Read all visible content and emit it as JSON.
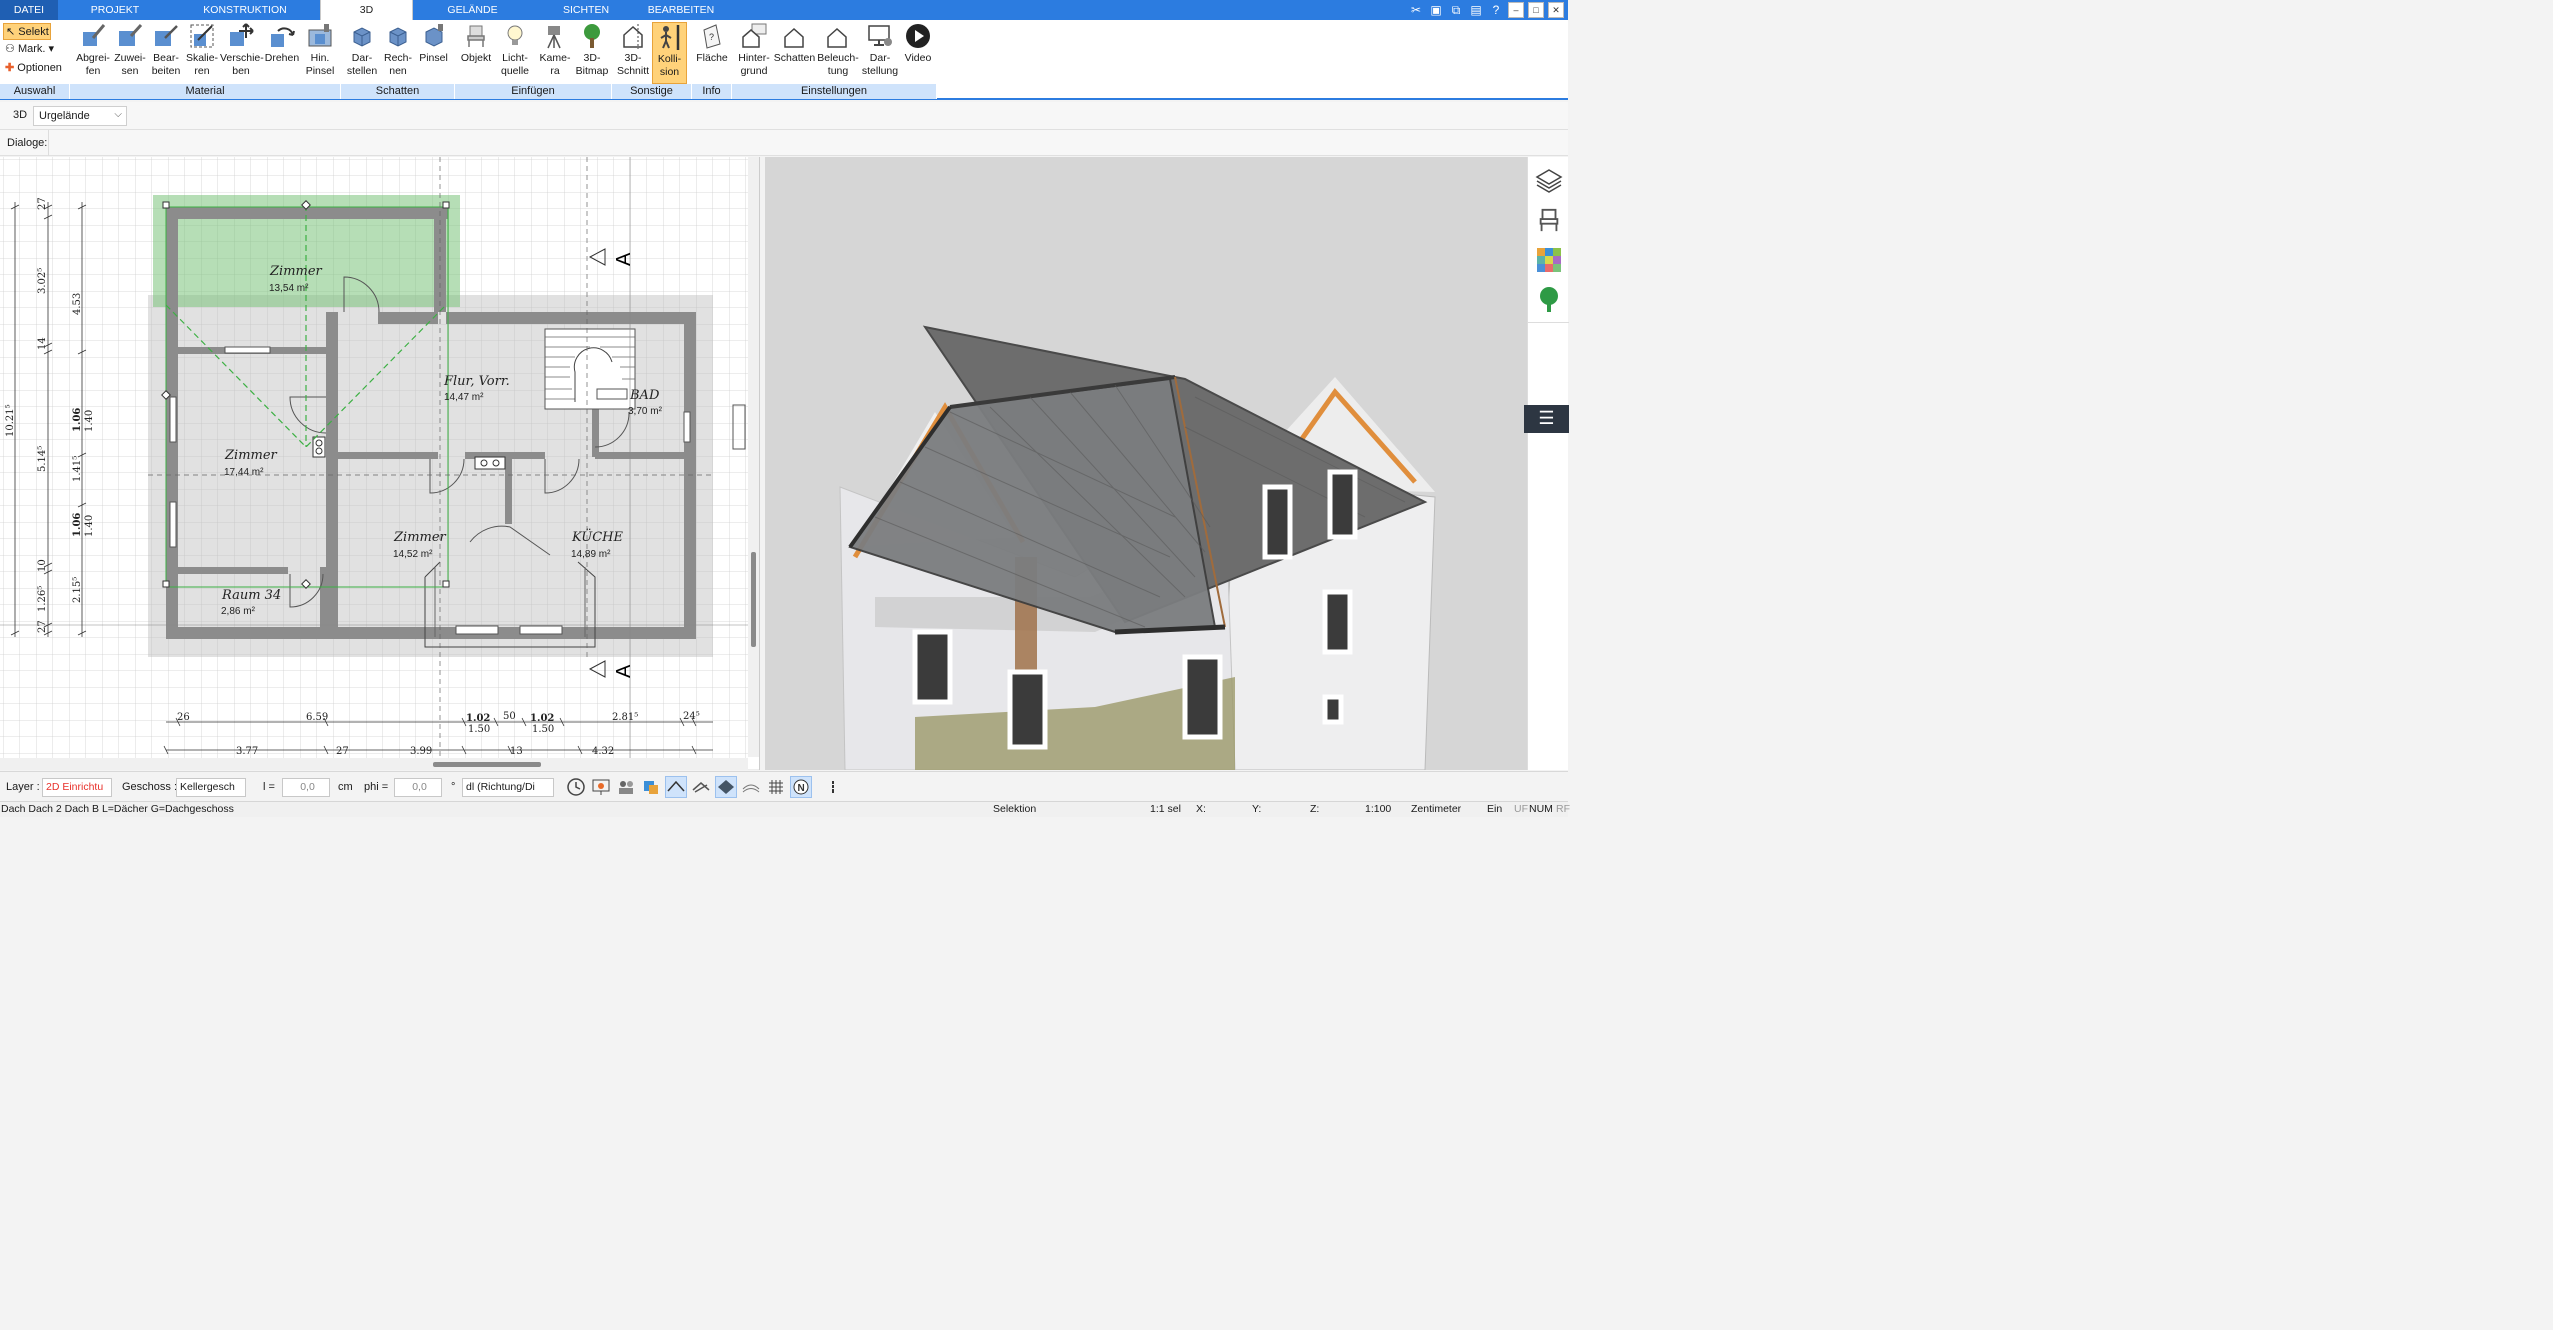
{
  "menu_tabs": [
    "DATEI",
    "PROJEKT",
    "KONSTRUKTION",
    "3D",
    "GELÄNDE",
    "SICHTEN",
    "BEARBEITEN"
  ],
  "ribbon": {
    "auswahl": {
      "select": "Selekt",
      "mark": "Mark.",
      "options": "Optionen"
    },
    "material": {
      "b1": "Abgrei-\nfen",
      "b2": "Zuwei-\nsen",
      "b3": "Bear-\nbeiten",
      "b4": "Skalie-\nren",
      "b5": "Verschie-\nben",
      "b6": "Drehen",
      "b7": "Hin.\nPinsel"
    },
    "schatten": {
      "b1": "Dar-\nstellen",
      "b2": "Rech-\nnen",
      "b3": "Pinsel"
    },
    "einfuegen": {
      "b1": "Objekt",
      "b2": "Licht-\nquelle",
      "b3": "Kame-\nra",
      "b4": "3D-\nBitmap"
    },
    "sonstige": {
      "b1": "3D-\nSchnitt",
      "b2": "Kolli-\nsion"
    },
    "info": {
      "b1": "Fläche"
    },
    "einstellungen": {
      "b1": "Hinter-\ngrund",
      "b2": "Schatten",
      "b3": "Beleuch-\ntung",
      "b4": "Dar-\nstellung",
      "b5": "Video"
    },
    "groups": [
      "Auswahl",
      "Material",
      "Schatten",
      "Einfügen",
      "Sonstige",
      "Info",
      "Einstellungen"
    ]
  },
  "subbar": {
    "mode": "3D",
    "layer_select": "Urgelände",
    "dialoge": "Dialoge:"
  },
  "plan": {
    "rooms": [
      {
        "name": "Zimmer",
        "area": "13,54 m²"
      },
      {
        "name": "Flur, Vorr.",
        "area": "14,47 m²"
      },
      {
        "name": "BAD",
        "area": "3,70 m²"
      },
      {
        "name": "Zimmer",
        "area": "17,44 m²"
      },
      {
        "name": "Zimmer",
        "area": "14,52 m²"
      },
      {
        "name": "KÜCHE",
        "area": "14,89 m²"
      },
      {
        "name": "Raum 34",
        "area": "2,86 m²"
      }
    ],
    "section_label": "A",
    "dims_bottom": [
      "26",
      "6.59",
      "1.02",
      "50",
      "1.02",
      "2.81⁵",
      "24⁵"
    ],
    "dims_bottom_sub": [
      "1.50",
      "1.50"
    ],
    "dims_bottom2": [
      "3.77",
      "27",
      "3.99",
      "13",
      "4.32"
    ],
    "dims_left_outer": [
      "10.21⁵"
    ],
    "dims_left_mid": [
      "27",
      "3.02⁵",
      "14",
      "5.14⁵",
      "10",
      "1.26⁵",
      "27"
    ],
    "dims_left_inner": [
      "4.53",
      "1.06",
      "1.40",
      "1.41⁵",
      "1.06",
      "1.40",
      "2.15⁵"
    ]
  },
  "bottom": {
    "layer_label": "Layer :",
    "layer_value": "2D Einrichtu",
    "geschoss_label": "Geschoss :",
    "geschoss_value": "Kellergesch",
    "l_label": "l =",
    "l_value": "0,0",
    "l_unit": "cm",
    "phi_label": "phi =",
    "phi_value": "0,0",
    "phi_unit": "°",
    "dl_value": "dl (Richtung/Di"
  },
  "status": {
    "left": "Dach Dach 2 Dach B L=Dächer G=Dachgeschoss",
    "mode": "Selektion",
    "sel": "1:1 sel",
    "x": "X:",
    "y": "Y:",
    "z": "Z:",
    "scale": "1:100",
    "unit": "Zentimeter",
    "ein": "Ein",
    "flags": [
      "UF",
      "NUM",
      "RF"
    ]
  },
  "colors": {
    "accent": "#2c7ce0",
    "group_label": "#cfe3fb",
    "active": "#ffd27a",
    "wall": "#8c8c8c",
    "green": "#3cb043"
  }
}
